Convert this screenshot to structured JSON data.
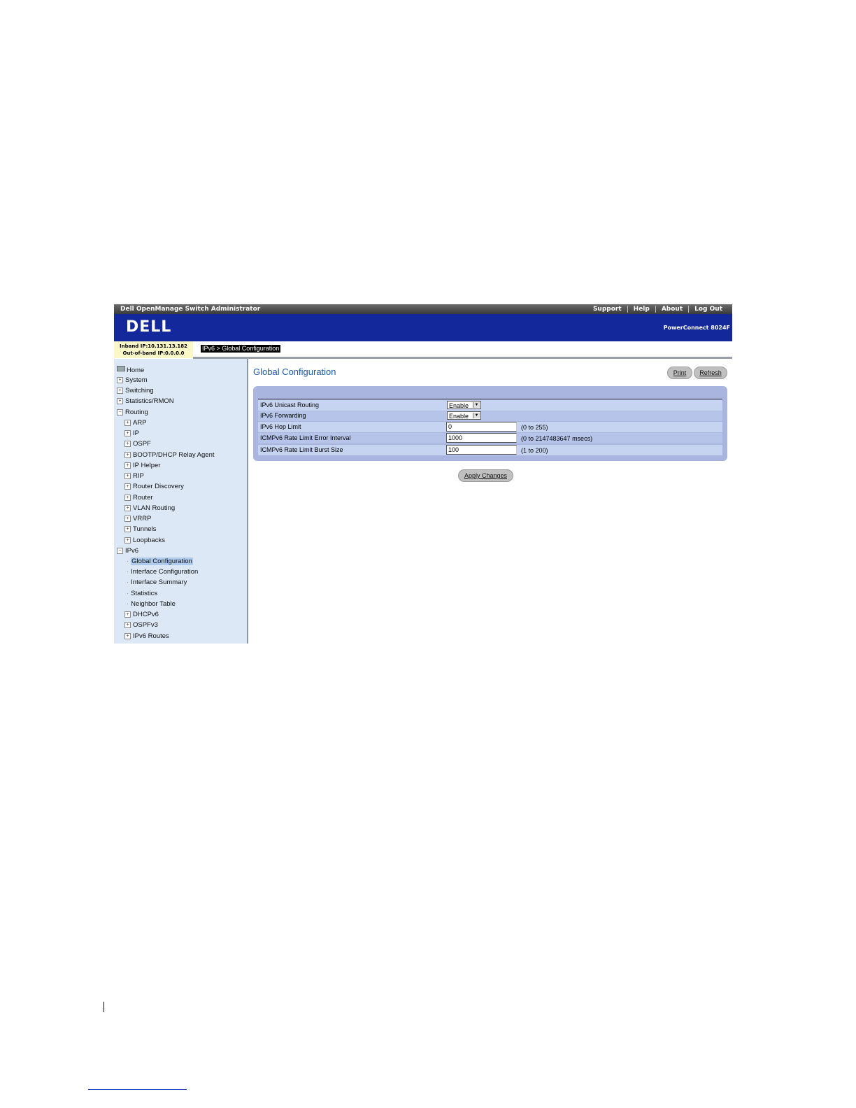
{
  "topbar": {
    "title": "Dell OpenManage Switch Administrator",
    "links": [
      "Support",
      "Help",
      "About",
      "Log Out"
    ]
  },
  "banner": {
    "logo": "DELL",
    "product": "PowerConnect 8024F"
  },
  "ipinfo": {
    "inband": "Inband IP:10.131.13.182",
    "outofband": "Out-of-band IP:0.0.0.0"
  },
  "breadcrumb": "IPv6 > Global Configuration",
  "sidebar": {
    "items": [
      {
        "label": "Home"
      },
      {
        "label": "System"
      },
      {
        "label": "Switching"
      },
      {
        "label": "Statistics/RMON"
      },
      {
        "label": "Routing"
      },
      {
        "label": "ARP"
      },
      {
        "label": "IP"
      },
      {
        "label": "OSPF"
      },
      {
        "label": "BOOTP/DHCP Relay Agent"
      },
      {
        "label": "IP Helper"
      },
      {
        "label": "RIP"
      },
      {
        "label": "Router Discovery"
      },
      {
        "label": "Router"
      },
      {
        "label": "VLAN Routing"
      },
      {
        "label": "VRRP"
      },
      {
        "label": "Tunnels"
      },
      {
        "label": "Loopbacks"
      },
      {
        "label": "IPv6"
      },
      {
        "label": "Global Configuration"
      },
      {
        "label": "Interface Configuration"
      },
      {
        "label": "Interface Summary"
      },
      {
        "label": "Statistics"
      },
      {
        "label": "Neighbor Table"
      },
      {
        "label": "DHCPv6"
      },
      {
        "label": "OSPFv3"
      },
      {
        "label": "IPv6 Routes"
      }
    ]
  },
  "main": {
    "title": "Global Configuration",
    "print_label": "Print",
    "refresh_label": "Refresh",
    "apply_label": "Apply Changes",
    "fields": [
      {
        "label": "IPv6 Unicast Routing",
        "value": "Enable"
      },
      {
        "label": "IPv6 Forwarding",
        "value": "Enable"
      },
      {
        "label": "IPv6 Hop Limit",
        "value": "0",
        "range": "(0 to 255)"
      },
      {
        "label": "ICMPv6 Rate Limit Error Interval",
        "value": "1000",
        "range": "(0 to 2147483647 msecs)"
      },
      {
        "label": "ICMPv6 Rate Limit Burst Size",
        "value": "100",
        "range": "(1 to 200)"
      }
    ]
  }
}
